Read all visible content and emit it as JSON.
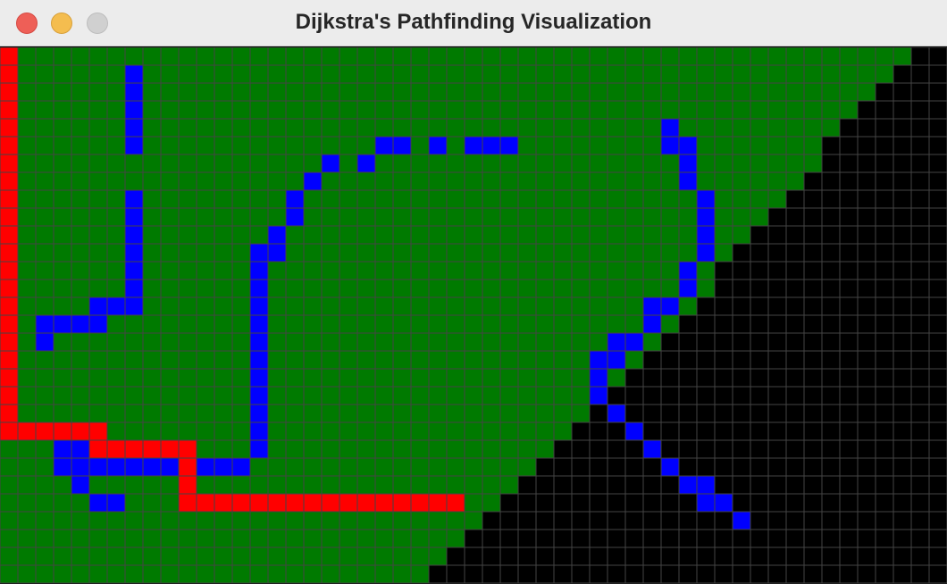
{
  "window": {
    "title": "Dijkstra's Pathfinding Visualization",
    "controls": [
      "close-button",
      "minimize-button",
      "zoom-button"
    ]
  },
  "grid": {
    "columns": 53,
    "rows": 30,
    "colors": {
      "unvisited": "#000000",
      "visited": "#007a00",
      "wall": "#0000ff",
      "path": "#ff0000",
      "gridline": "#444444"
    },
    "wall_cells": [
      [
        7,
        1
      ],
      [
        7,
        2
      ],
      [
        7,
        3
      ],
      [
        7,
        4
      ],
      [
        7,
        5
      ],
      [
        7,
        8
      ],
      [
        7,
        9
      ],
      [
        7,
        10
      ],
      [
        7,
        11
      ],
      [
        7,
        12
      ],
      [
        7,
        13
      ],
      [
        7,
        14
      ],
      [
        6,
        14
      ],
      [
        5,
        14
      ],
      [
        5,
        15
      ],
      [
        4,
        15
      ],
      [
        3,
        15
      ],
      [
        2,
        15
      ],
      [
        2,
        16
      ],
      [
        21,
        5
      ],
      [
        22,
        5
      ],
      [
        24,
        5
      ],
      [
        26,
        5
      ],
      [
        27,
        5
      ],
      [
        28,
        5
      ],
      [
        18,
        6
      ],
      [
        20,
        6
      ],
      [
        17,
        7
      ],
      [
        16,
        8
      ],
      [
        16,
        9
      ],
      [
        15,
        10
      ],
      [
        15,
        11
      ],
      [
        14,
        11
      ],
      [
        14,
        12
      ],
      [
        14,
        13
      ],
      [
        14,
        14
      ],
      [
        14,
        15
      ],
      [
        14,
        16
      ],
      [
        14,
        17
      ],
      [
        14,
        18
      ],
      [
        14,
        19
      ],
      [
        14,
        20
      ],
      [
        14,
        21
      ],
      [
        14,
        22
      ],
      [
        13,
        23
      ],
      [
        12,
        23
      ],
      [
        11,
        23
      ],
      [
        3,
        22
      ],
      [
        4,
        22
      ],
      [
        3,
        23
      ],
      [
        4,
        23
      ],
      [
        5,
        23
      ],
      [
        6,
        23
      ],
      [
        7,
        23
      ],
      [
        8,
        23
      ],
      [
        9,
        23
      ],
      [
        4,
        24
      ],
      [
        5,
        25
      ],
      [
        6,
        25
      ],
      [
        37,
        4
      ],
      [
        37,
        5
      ],
      [
        38,
        5
      ],
      [
        38,
        6
      ],
      [
        38,
        7
      ],
      [
        39,
        8
      ],
      [
        39,
        9
      ],
      [
        39,
        10
      ],
      [
        39,
        11
      ],
      [
        38,
        12
      ],
      [
        38,
        13
      ],
      [
        37,
        14
      ],
      [
        36,
        14
      ],
      [
        36,
        15
      ],
      [
        35,
        16
      ],
      [
        34,
        16
      ],
      [
        34,
        17
      ],
      [
        33,
        17
      ],
      [
        33,
        18
      ],
      [
        33,
        19
      ],
      [
        34,
        20
      ],
      [
        35,
        21
      ],
      [
        36,
        22
      ],
      [
        37,
        23
      ],
      [
        38,
        24
      ],
      [
        39,
        24
      ],
      [
        39,
        25
      ],
      [
        40,
        25
      ],
      [
        41,
        26
      ]
    ],
    "path_cells": [
      [
        0,
        0
      ],
      [
        0,
        1
      ],
      [
        0,
        2
      ],
      [
        0,
        3
      ],
      [
        0,
        4
      ],
      [
        0,
        5
      ],
      [
        0,
        6
      ],
      [
        0,
        7
      ],
      [
        0,
        8
      ],
      [
        0,
        9
      ],
      [
        0,
        10
      ],
      [
        0,
        11
      ],
      [
        0,
        12
      ],
      [
        0,
        13
      ],
      [
        0,
        14
      ],
      [
        0,
        15
      ],
      [
        0,
        16
      ],
      [
        0,
        17
      ],
      [
        0,
        18
      ],
      [
        0,
        19
      ],
      [
        0,
        20
      ],
      [
        0,
        21
      ],
      [
        1,
        21
      ],
      [
        2,
        21
      ],
      [
        3,
        21
      ],
      [
        4,
        21
      ],
      [
        5,
        21
      ],
      [
        5,
        22
      ],
      [
        6,
        22
      ],
      [
        7,
        22
      ],
      [
        8,
        22
      ],
      [
        9,
        22
      ],
      [
        10,
        22
      ],
      [
        10,
        23
      ],
      [
        10,
        24
      ],
      [
        10,
        25
      ],
      [
        11,
        25
      ],
      [
        12,
        25
      ],
      [
        13,
        25
      ],
      [
        14,
        25
      ],
      [
        15,
        25
      ],
      [
        16,
        25
      ],
      [
        17,
        25
      ],
      [
        18,
        25
      ],
      [
        19,
        25
      ],
      [
        20,
        25
      ],
      [
        21,
        25
      ],
      [
        22,
        25
      ],
      [
        23,
        25
      ],
      [
        24,
        25
      ],
      [
        25,
        25
      ]
    ],
    "visited_row_ends": [
      50,
      49,
      48,
      47,
      46,
      45,
      45,
      44,
      43,
      42,
      41,
      40,
      39,
      39,
      38,
      37,
      36,
      35,
      34,
      33,
      32,
      31,
      30,
      29,
      28,
      27,
      26,
      25,
      24,
      23
    ]
  }
}
